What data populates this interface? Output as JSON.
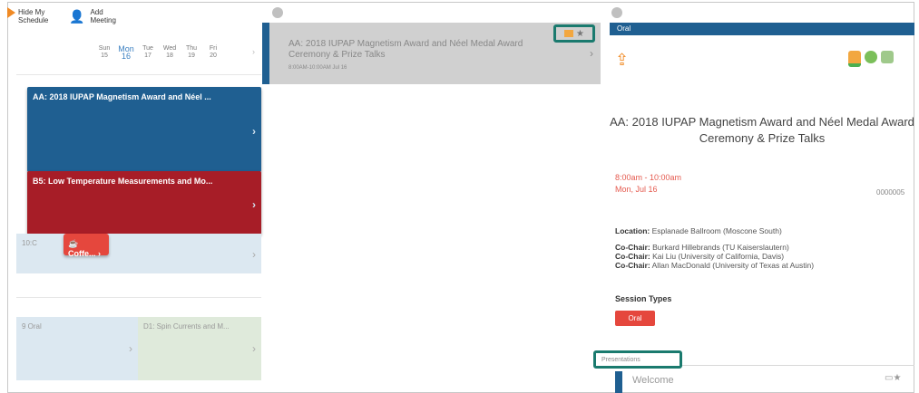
{
  "left": {
    "hide_schedule": "Hide My Schedule",
    "add_meeting": "Add Meeting",
    "days": [
      {
        "name": "Sun",
        "num": "15"
      },
      {
        "name": "Mon",
        "num": "16"
      },
      {
        "name": "Tue",
        "num": "17"
      },
      {
        "name": "Wed",
        "num": "18"
      },
      {
        "name": "Thu",
        "num": "19"
      },
      {
        "name": "Fri",
        "num": "20"
      }
    ],
    "event_blue": "AA: 2018 IUPAP Magnetism Award and Néel ...",
    "event_red": "B5: Low Temperature Measurements and Mo...",
    "coffee": "Coffe...",
    "slot_label": "10:C",
    "bottom_left": "9 Oral",
    "bottom_right": "D1: Spin Currents and M..."
  },
  "middle": {
    "title": "AA: 2018 IUPAP Magnetism Award and Néel Medal Award Ceremony & Prize Talks",
    "time": "8:00AM-10:00AM Jul 16"
  },
  "right": {
    "header": "Oral",
    "title": "AA: 2018 IUPAP Magnetism Award and Néel Medal Award Ceremony & Prize Talks",
    "time": "8:00am - 10:00am",
    "date": "Mon, Jul 16",
    "number": "0000005",
    "location_label": "Location:",
    "location": "Esplanade Ballroom (Moscone South)",
    "cochairs": [
      {
        "label": "Co-Chair:",
        "name": "Burkard Hillebrands (TU Kaiserslautern)"
      },
      {
        "label": "Co-Chair:",
        "name": "Kai Liu (University of California, Davis)"
      },
      {
        "label": "Co-Chair:",
        "name": "Allan MacDonald (University of Texas at Austin)"
      }
    ],
    "session_types_label": "Session Types",
    "session_type": "Oral",
    "presentations_label": "Presentations",
    "welcome": "Welcome"
  }
}
